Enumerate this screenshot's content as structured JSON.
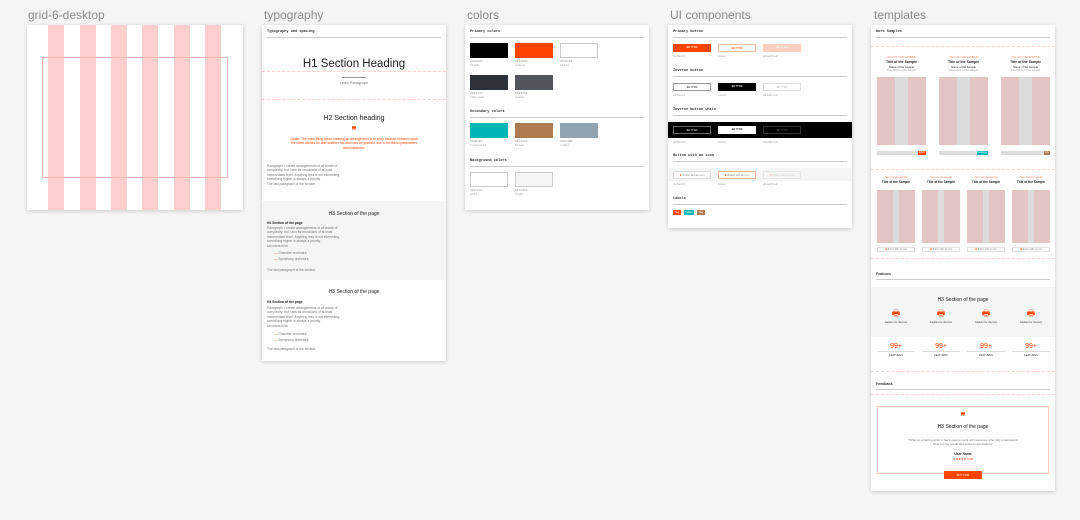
{
  "canvas": {
    "labels": [
      "grid-6-desktop",
      "typography",
      "colors",
      "UI components",
      "templates"
    ]
  },
  "typography": {
    "header": "Typography and spacing",
    "h1": "H1 Section Heading",
    "lead": "Lead Paragraph",
    "h2": "H2 Section heading",
    "quote": "Quote. The main thing about creating an arrangement is to keep balance between what the client wishes for and whether his wish can be granted, due to technical parameters and limitations.",
    "paragraph": "Paragraph. I create arrangements of all levels of complexity, but I aim for musicians of at least intermediate level. Anything less is not interesting, something higher is always a priority.",
    "last": "The last paragraph of the section.",
    "sections": [
      {
        "h3": "H3 Section of the page",
        "h4": "H4 Section of the page",
        "list_title": "Unordered list:",
        "items": [
          "Chamber orchestra",
          "Symphony orchestra"
        ]
      },
      {
        "h3": "H3 Section of the page",
        "h4": "H4 Section of the page",
        "list_title": "Unordered list:",
        "items": [
          "Chamber orchestra",
          "Symphony orchestra"
        ]
      }
    ]
  },
  "colors": {
    "primary_title": "Primary colors",
    "secondary_title": "Secondary colors",
    "background_title": "Background colors",
    "primary": [
      {
        "hex": "#000000",
        "name": "black"
      },
      {
        "hex": "#FF4500",
        "name": "orange"
      },
      {
        "hex": "#FFFFFF",
        "name": "white"
      },
      {
        "hex": "#2E3138",
        "name": "charcoal"
      },
      {
        "hex": "#54565E",
        "name": "slate"
      }
    ],
    "secondary": [
      {
        "hex": "#00B5B5",
        "name": "turquoise"
      },
      {
        "hex": "#B07A50",
        "name": "brown"
      },
      {
        "hex": "#8FA3B0",
        "name": "rocky"
      }
    ],
    "background": [
      {
        "hex": "#FFFFFF",
        "name": "white"
      },
      {
        "hex": "#F4F6F6",
        "name": "light"
      }
    ]
  },
  "ui": {
    "primary_title": "Primary button",
    "inverse_title": "Inverse button",
    "inverse_white_title": "Inverse button white",
    "icon_title": "Button with an icon",
    "labels_title": "Labels",
    "button": "BUTTON",
    "icon_button": "Button with an icon",
    "states": [
      "default",
      "hover",
      "disabled"
    ],
    "labels": [
      "Tag",
      "Label",
      "Tag"
    ]
  },
  "templates": {
    "work_title": "Work Samples",
    "cards": [
      {
        "tag": "TAG OF THE SAMPLE",
        "title": "Title of the Sample",
        "name": "Name of the sample",
        "desc": "Description of the sample",
        "color": "#FF4500",
        "pct": "100%"
      },
      {
        "tag": "TAG OF THE SAMPLE",
        "title": "Title of the Sample",
        "name": "Name of the sample",
        "desc": "Description of the sample",
        "color": "#00B5B5",
        "pct": "Features"
      },
      {
        "tag": "TAG OF THE SAMPLE",
        "title": "Title of the Sample",
        "name": "Name of the sample",
        "desc": "Description of the sample",
        "color": "#B07A50",
        "pct": "Info"
      }
    ],
    "small_cards": [
      {
        "tag": "Tag of small sample",
        "title": "Title of the Sample",
        "button": "Button with an icon"
      },
      {
        "tag": "Tag of small sample",
        "title": "Title of the Sample",
        "button": "Button with an icon"
      },
      {
        "tag": "Tag of small sample",
        "title": "Title of the Sample",
        "button": "Button with an icon"
      },
      {
        "tag": "Tag of small sample",
        "title": "Title of the Sample",
        "button": "Button with an icon"
      }
    ],
    "features_title": "Features",
    "features_h3": "H3 Section of the page",
    "features": [
      {
        "icon": "printer-icon",
        "caption": "Caption for the icon"
      },
      {
        "icon": "printer-icon",
        "caption": "Caption for the icon"
      },
      {
        "icon": "printer-icon",
        "caption": "Caption for the icon"
      },
      {
        "icon": "printer-icon",
        "caption": "Caption for the icon"
      }
    ],
    "stats": [
      {
        "value": "99+",
        "label": "FEATURES"
      },
      {
        "value": "99+",
        "label": "FEATURES"
      },
      {
        "value": "99+",
        "label": "FEATURES"
      },
      {
        "value": "99+",
        "label": "FEATURES"
      }
    ],
    "feedback_title": "Feedback",
    "feedback_h3": "H3 Section of the page",
    "feedback_text": "\"What an amazing artist. It feels good to work with someone who truly understands what a song needs and exceed expectations\"",
    "user": "User Name",
    "stars": "★★★★★",
    "rating": "5.00",
    "cta": "BUY FOR"
  },
  "accent": "#FF4500"
}
